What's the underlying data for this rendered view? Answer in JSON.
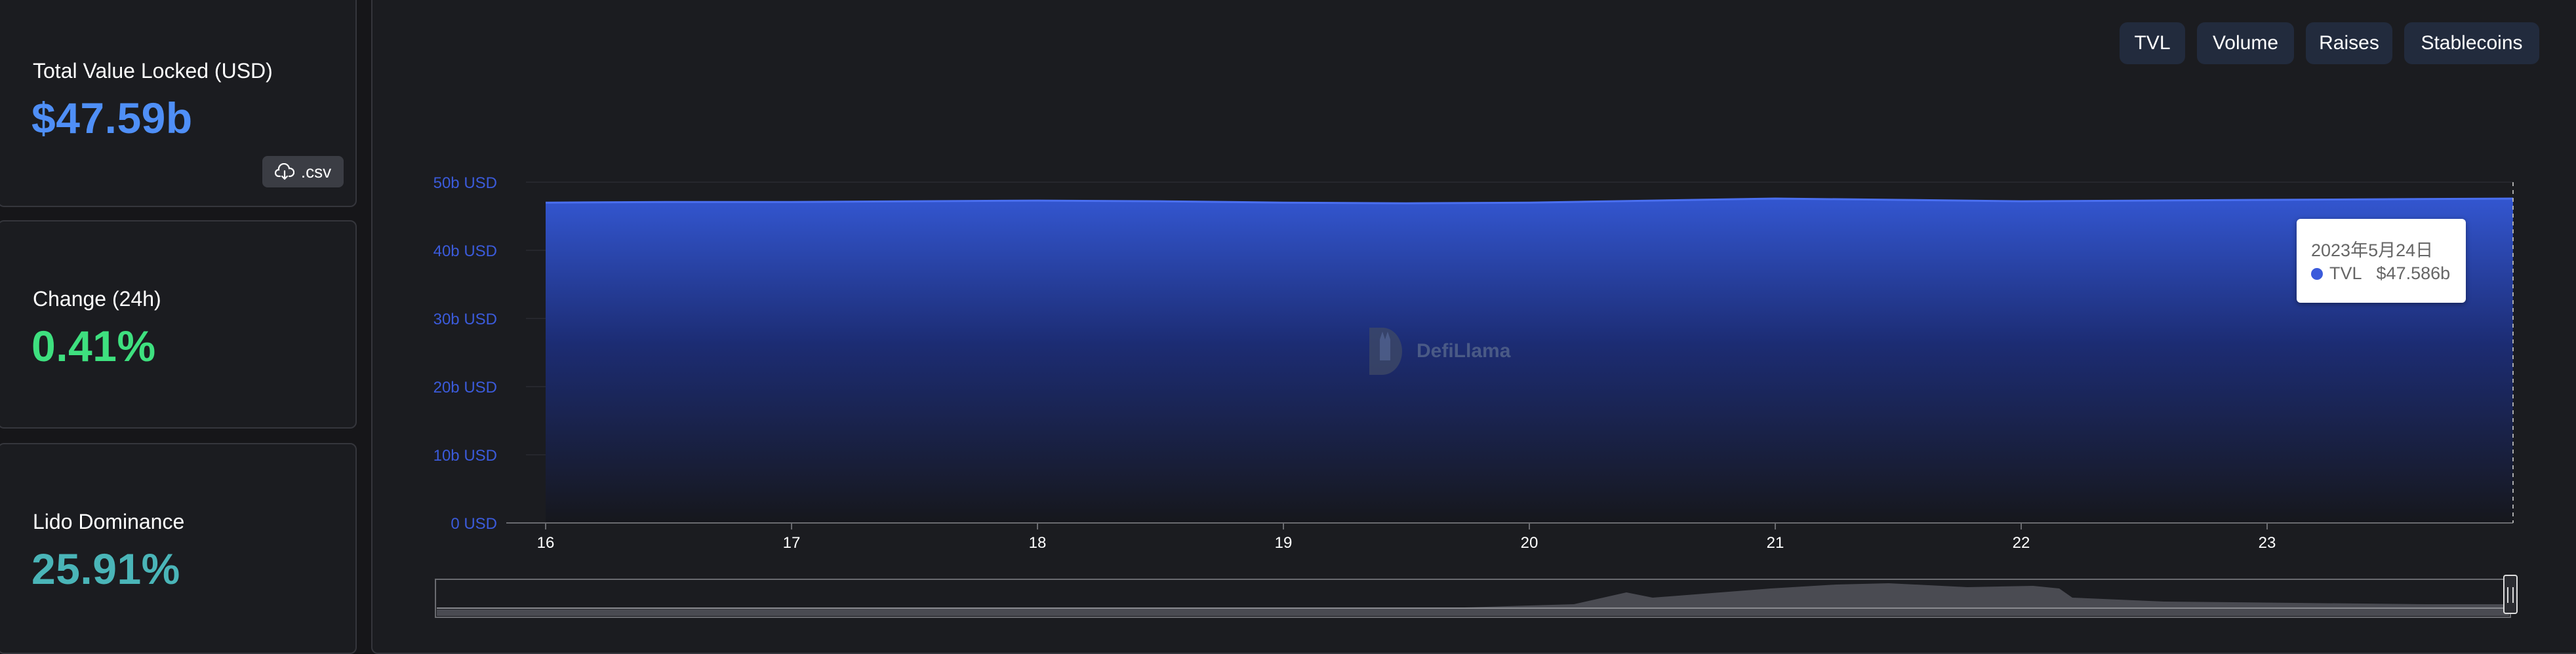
{
  "stats": {
    "tvl": {
      "label": "Total Value Locked (USD)",
      "value": "$47.59b",
      "csv_label": ".csv"
    },
    "change": {
      "label": "Change (24h)",
      "value": "0.41%"
    },
    "dominance": {
      "label": "Lido Dominance",
      "value": "25.91%"
    }
  },
  "tabs": [
    "TVL",
    "Volume",
    "Raises",
    "Stablecoins"
  ],
  "tooltip": {
    "date": "2023年5月24日",
    "series": "TVL",
    "value": "$47.586b"
  },
  "watermark": "DefiLlama",
  "colors": {
    "tvl": "#4f8ff7",
    "change": "#3ee07f",
    "dominance": "#4ab5b8",
    "series": "#3b5bdb"
  },
  "chart_data": {
    "type": "area",
    "x": [
      "16",
      "16.5",
      "17",
      "17.5",
      "18",
      "18.5",
      "19",
      "19.5",
      "20",
      "20.5",
      "21",
      "21.5",
      "22",
      "22.5",
      "23",
      "23.5",
      "24"
    ],
    "xticks": [
      "16",
      "17",
      "18",
      "19",
      "20",
      "21",
      "22",
      "23"
    ],
    "series": [
      {
        "name": "TVL",
        "values": [
          47.0,
          47.1,
          47.1,
          47.2,
          47.3,
          47.2,
          47.0,
          46.9,
          47.0,
          47.3,
          47.6,
          47.4,
          47.2,
          47.3,
          47.4,
          47.5,
          47.6
        ]
      }
    ],
    "yticks": [
      "0 USD",
      "10b USD",
      "20b USD",
      "30b USD",
      "40b USD",
      "50b USD"
    ],
    "ylim": [
      0,
      50
    ],
    "grid": true
  }
}
